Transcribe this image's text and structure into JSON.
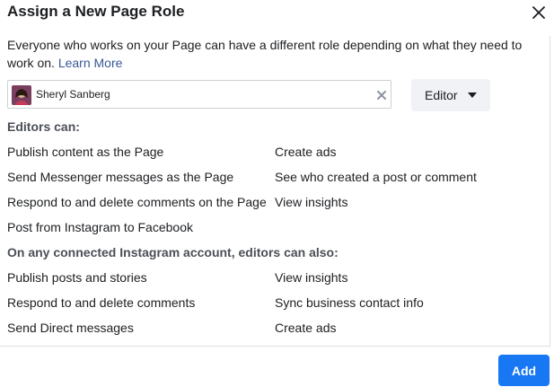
{
  "dialog": {
    "title": "Assign a New Page Role",
    "close_icon": "close-icon"
  },
  "description": {
    "text": "Everyone who works on your Page can have a different role depending on what they need to work on.",
    "link": "Learn More"
  },
  "assignee": {
    "name": "Sheryl Sanberg",
    "clear_icon": "clear-icon"
  },
  "role": {
    "selected": "Editor",
    "caret_icon": "caret-down-icon"
  },
  "editors_section": {
    "title": "Editors can:",
    "left": [
      "Publish content as the Page",
      "Send Messenger messages as the Page",
      "Respond to and delete comments on the Page",
      "Post from Instagram to Facebook"
    ],
    "right": [
      "Create ads",
      "See who created a post or comment",
      "View insights"
    ]
  },
  "instagram_section": {
    "title": "On any connected Instagram account, editors can also:",
    "left": [
      "Publish posts and stories",
      "Respond to and delete comments",
      "Send Direct messages"
    ],
    "right": [
      "View insights",
      "Sync business contact info",
      "Create ads"
    ]
  },
  "footer": {
    "add_label": "Add"
  },
  "colors": {
    "primary": "#1877f2",
    "link": "#385898",
    "text": "#1c1e21",
    "muted_heading": "#4b4f56",
    "select_bg": "#f0f2f5"
  }
}
